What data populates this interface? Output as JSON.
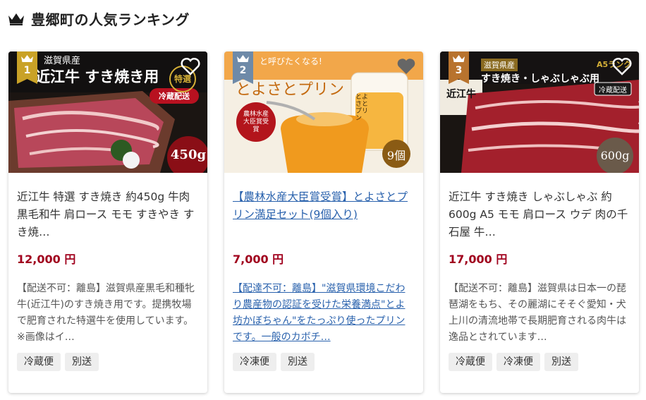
{
  "ranking": {
    "title": "豊郷町の人気ランキング",
    "accent_color": "#a0001d",
    "link_color": "#2a62ad",
    "items": [
      {
        "rank": "1",
        "rank_color": "#c9a227",
        "image": {
          "headline": "近江牛 すき焼き用",
          "prefix": "滋賀県産",
          "badge_tokusen": "特選",
          "label_reizou": "冷蔵配送",
          "weight": "450g"
        },
        "title": "近江牛 特選 すき焼き 約450g 牛肉 黒毛和牛 肩ロース モモ すきやき すき焼…",
        "price": "12,000 円",
        "description": "【配送不可：離島】滋賀県産黒毛和種牝牛(近江牛)のすき焼き用です。提携牧場で肥育された特選牛を使用しています。※画像はイ…",
        "tags": [
          "冷蔵便",
          "別送"
        ]
      },
      {
        "rank": "2",
        "rank_color": "#6e8aa8",
        "image": {
          "tagline": "と呼びたくなる!",
          "headline": "とよさとプリン",
          "award": "農林水産大臣賞受賞",
          "jar_label": "とよさとプリン",
          "count": "9個"
        },
        "title": "【農林水産大臣賞受賞】とよさとプリン満足セット(9個入り)",
        "price": "7,000 円",
        "description": "【配達不可：離島】\"滋賀県環境こだわり農産物の認証を受けた栄養満点\"とよ坊かぼちゃん\"をたっぷり使ったプリンです。一般のカボチ…",
        "tags": [
          "冷凍便",
          "別送"
        ]
      },
      {
        "rank": "3",
        "rank_color": "#b8732e",
        "image": {
          "prefix": "滋賀県産",
          "headline": "すき焼き・しゃぶしゃぶ用",
          "rank_label": "A5ランク",
          "label_reizou": "冷蔵配送",
          "brand": "近江牛",
          "weight": "600g"
        },
        "title": "近江牛 すき焼き しゃぶしゃぶ 約600g A5 モモ 肩ロース ウデ 肉の千石屋 牛…",
        "price": "17,000 円",
        "description": "【配送不可：離島】滋賀県は日本一の琵琶湖をもち、その麗湖にそそぐ愛知・犬上川の清流地帯で長期肥育される肉牛は逸品とされています…",
        "tags": [
          "冷蔵便",
          "冷凍便",
          "別送"
        ]
      }
    ]
  }
}
